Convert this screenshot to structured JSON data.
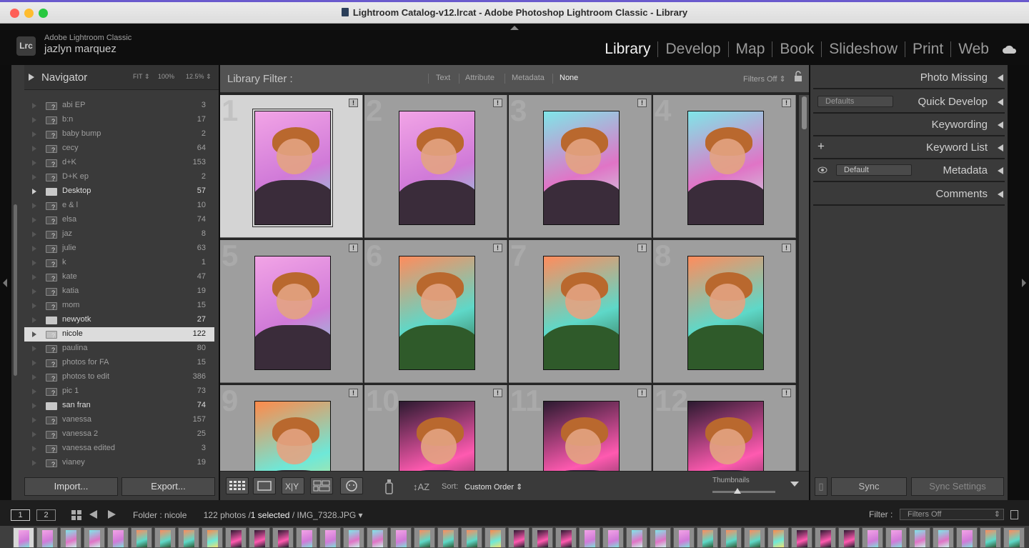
{
  "window": {
    "title": "Lightroom Catalog-v12.lrcat - Adobe Photoshop Lightroom Classic - Library"
  },
  "identity": {
    "logo_text": "Lrc",
    "app_name": "Adobe Lightroom Classic",
    "user_name": "jazlyn marquez"
  },
  "modules": [
    "Library",
    "Develop",
    "Map",
    "Book",
    "Slideshow",
    "Print",
    "Web"
  ],
  "active_module": "Library",
  "navigator": {
    "title": "Navigator",
    "options": [
      "FIT",
      "100%",
      "12.5%"
    ]
  },
  "folders": [
    {
      "name": "abi EP",
      "count": "3",
      "type": "missing"
    },
    {
      "name": "b:n",
      "count": "17",
      "type": "missing"
    },
    {
      "name": "baby bump",
      "count": "2",
      "type": "missing"
    },
    {
      "name": "cecy",
      "count": "64",
      "type": "missing"
    },
    {
      "name": "d+K",
      "count": "153",
      "type": "missing"
    },
    {
      "name": "D+K ep",
      "count": "2",
      "type": "missing"
    },
    {
      "name": "Desktop",
      "count": "57",
      "type": "folder"
    },
    {
      "name": "e & l",
      "count": "10",
      "type": "missing"
    },
    {
      "name": "elsa",
      "count": "74",
      "type": "missing"
    },
    {
      "name": "jaz",
      "count": "8",
      "type": "missing"
    },
    {
      "name": "julie",
      "count": "63",
      "type": "missing"
    },
    {
      "name": "k",
      "count": "1",
      "type": "missing"
    },
    {
      "name": "kate",
      "count": "47",
      "type": "missing"
    },
    {
      "name": "katia",
      "count": "19",
      "type": "missing"
    },
    {
      "name": "mom",
      "count": "15",
      "type": "missing"
    },
    {
      "name": "newyotk",
      "count": "27",
      "type": "folder"
    },
    {
      "name": "nicole",
      "count": "122",
      "type": "selected"
    },
    {
      "name": "paulina",
      "count": "80",
      "type": "missing"
    },
    {
      "name": "photos for FA",
      "count": "15",
      "type": "missing"
    },
    {
      "name": "photos to edit",
      "count": "386",
      "type": "missing"
    },
    {
      "name": "pic 1",
      "count": "73",
      "type": "missing"
    },
    {
      "name": "san fran",
      "count": "74",
      "type": "folder"
    },
    {
      "name": "vanessa",
      "count": "157",
      "type": "missing"
    },
    {
      "name": "vanessa 2",
      "count": "25",
      "type": "missing"
    },
    {
      "name": "vanessa edited",
      "count": "3",
      "type": "missing"
    },
    {
      "name": "vianey",
      "count": "19",
      "type": "missing"
    }
  ],
  "left_buttons": {
    "import": "Import...",
    "export": "Export..."
  },
  "library_filter": {
    "title": "Library Filter :",
    "options": [
      "Text",
      "Attribute",
      "Metadata",
      "None"
    ],
    "active": "None",
    "filters_off": "Filters Off"
  },
  "grid": {
    "cells": [
      {
        "number": "1",
        "selected": true,
        "scheme": "pink"
      },
      {
        "number": "2",
        "selected": false,
        "scheme": "pink"
      },
      {
        "number": "3",
        "selected": false,
        "scheme": "cyan"
      },
      {
        "number": "4",
        "selected": false,
        "scheme": "cyan"
      },
      {
        "number": "5",
        "selected": false,
        "scheme": "pink"
      },
      {
        "number": "6",
        "selected": false,
        "scheme": "warm"
      },
      {
        "number": "7",
        "selected": false,
        "scheme": "warm"
      },
      {
        "number": "8",
        "selected": false,
        "scheme": "warm"
      },
      {
        "number": "9",
        "selected": false,
        "scheme": "orange"
      },
      {
        "number": "10",
        "selected": false,
        "scheme": "dark"
      },
      {
        "number": "11",
        "selected": false,
        "scheme": "dark"
      },
      {
        "number": "12",
        "selected": false,
        "scheme": "dark"
      }
    ],
    "badge": "!"
  },
  "toolbar": {
    "sort_label": "Sort:",
    "sort_value": "Custom Order",
    "thumbnails_label": "Thumbnails",
    "thumbnail_size_fraction": 0.4
  },
  "right_panel": {
    "sections": [
      "Photo Missing",
      "Quick Develop",
      "Keywording",
      "Keyword List",
      "Metadata",
      "Comments"
    ],
    "quick_develop_preset": "Defaults",
    "metadata_preset": "Default",
    "sync": "Sync",
    "sync_settings": "Sync Settings"
  },
  "filmbar": {
    "page1": "1",
    "page2": "2",
    "folder_label": "Folder : nicole",
    "photo_count": "122 photos /",
    "selected_count": "1 selected",
    "file_name": "/ IMG_7328.JPG",
    "filter_label": "Filter :",
    "filter_value": "Filters Off"
  },
  "colors": {
    "pink": [
      "#f2a4e6",
      "#d07ad8",
      "#7ee0d8"
    ],
    "cyan": [
      "#7fe6e8",
      "#e074c6",
      "#c8f0e8"
    ],
    "warm": [
      "#ff8c5c",
      "#5ed8c8",
      "#2e5a36"
    ],
    "orange": [
      "#ff8a4a",
      "#6ee8d8",
      "#f0e070"
    ],
    "dark": [
      "#2c1a30",
      "#ff5ab0",
      "#1e1e2a"
    ]
  }
}
